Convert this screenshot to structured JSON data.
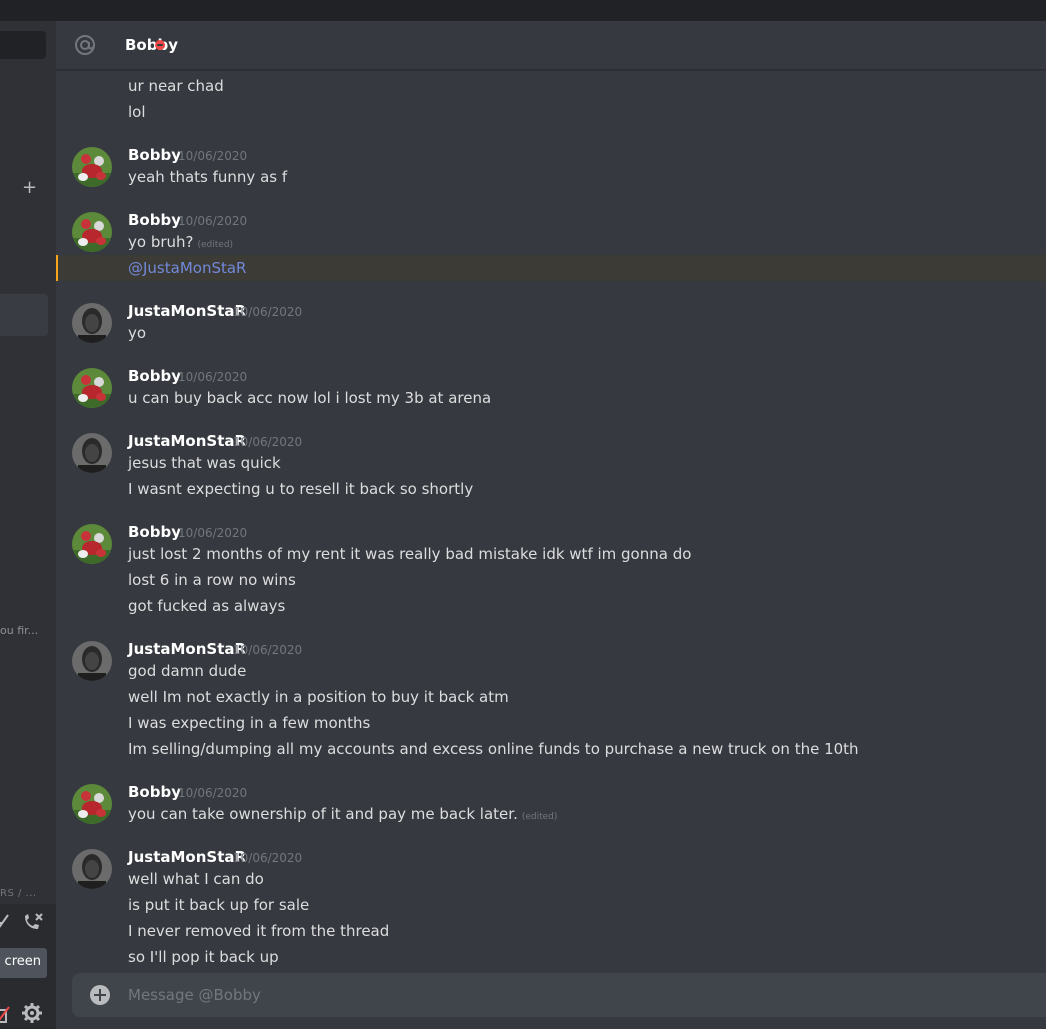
{
  "sidebar": {
    "add_symbol": "+",
    "truncated_dm_preview": "ou fir...",
    "truncated_voice_label": "RS / ...",
    "screen_button_label": "creen"
  },
  "header": {
    "channel_name": "Bobby",
    "status": "do-not-disturb",
    "status_color": "#f04747"
  },
  "colors": {
    "background": "#36393f",
    "sidebar": "#2f3136",
    "mention": "#7289da",
    "highlight_bar": "#faa61a"
  },
  "messages": {
    "m0": {
      "lines": [
        "ur near chad",
        "lol"
      ]
    },
    "m1": {
      "author": "Bobby",
      "timestamp": "10/06/2020",
      "lines": [
        "yeah thats funny as f"
      ]
    },
    "m2": {
      "author": "Bobby",
      "timestamp": "10/06/2020",
      "lines": [
        "yo bruh?"
      ],
      "edited": "(edited)",
      "mention": "@JustaMonStaR"
    },
    "m3": {
      "author": "JustaMonStaR",
      "timestamp": "10/06/2020",
      "lines": [
        "yo"
      ]
    },
    "m4": {
      "author": "Bobby",
      "timestamp": "10/06/2020",
      "lines": [
        "u can buy back acc now lol i lost my 3b at arena"
      ]
    },
    "m5": {
      "author": "JustaMonStaR",
      "timestamp": "10/06/2020",
      "lines": [
        "jesus that was quick",
        "I wasnt expecting u to resell it back so shortly"
      ]
    },
    "m6": {
      "author": "Bobby",
      "timestamp": "10/06/2020",
      "lines": [
        "just lost 2 months of my rent it was really bad mistake idk wtf im gonna do",
        "lost 6 in a row no wins",
        "got fucked as always"
      ]
    },
    "m7": {
      "author": "JustaMonStaR",
      "timestamp": "10/06/2020",
      "lines": [
        "god damn dude",
        "well Im not exactly in a position to buy it back atm",
        "I was expecting in a few months",
        "Im selling/dumping all my accounts and excess online funds to purchase a new truck on the 10th"
      ]
    },
    "m8": {
      "author": "Bobby",
      "timestamp": "10/06/2020",
      "lines": [
        "you can take ownership of it and pay me back later."
      ],
      "edited": "(edited)"
    },
    "m9": {
      "author": "JustaMonStaR",
      "timestamp": "10/06/2020",
      "lines": [
        "well what I can do",
        "is put it back up for sale",
        "I never removed it from the thread",
        "so I'll pop it back up"
      ]
    }
  },
  "composer": {
    "placeholder": "Message @Bobby"
  }
}
